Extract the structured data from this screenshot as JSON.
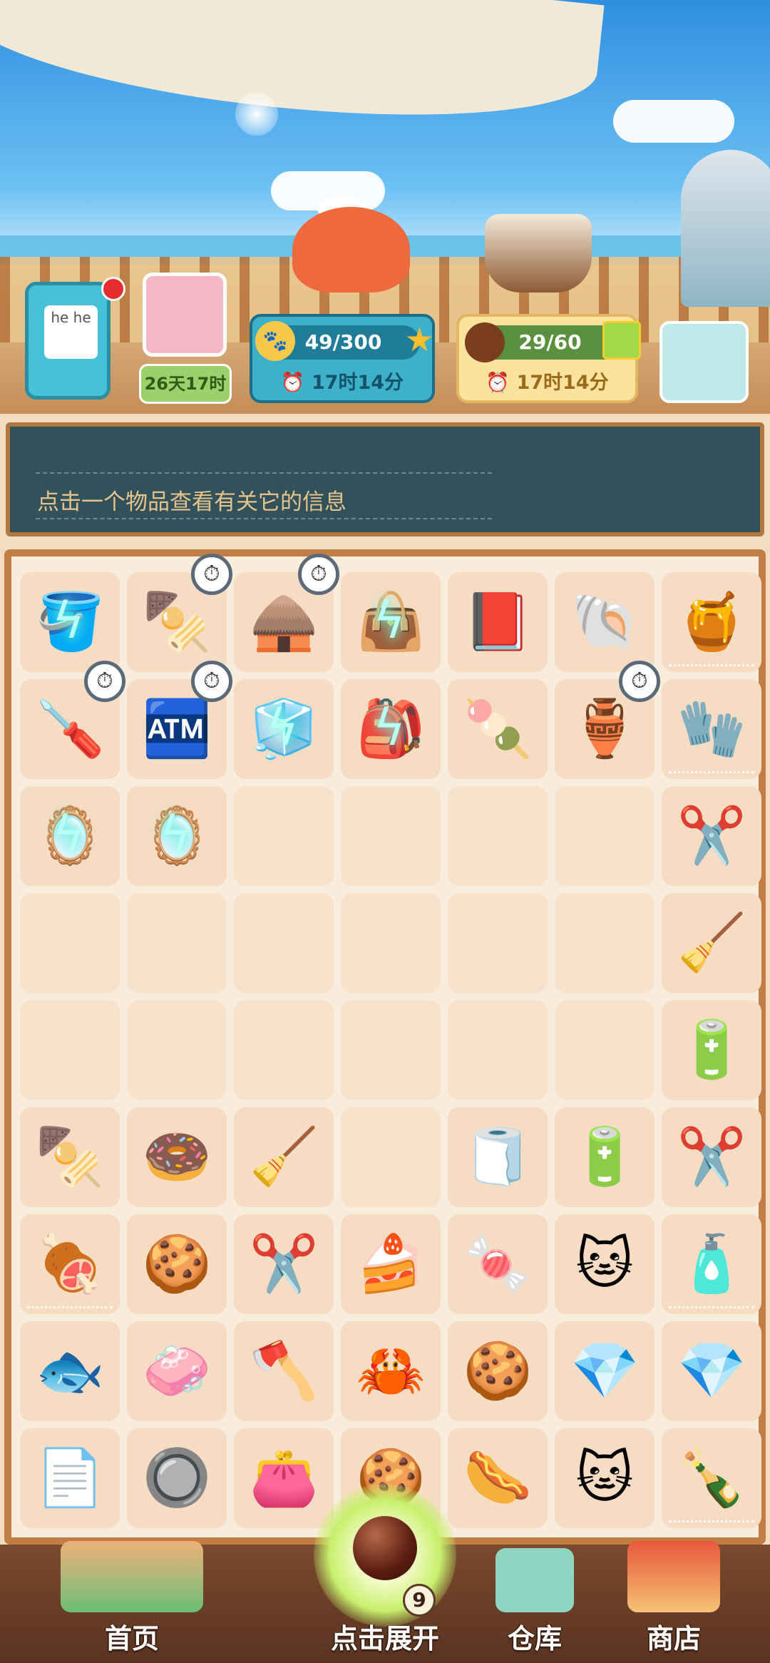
{
  "hud": {
    "avatar_timer": "26天17时",
    "energy": {
      "value": "49/300",
      "timer": "17时14分"
    },
    "cookies": {
      "value": "29/60",
      "timer": "17时14分"
    },
    "journal_text": "he he"
  },
  "info": {
    "message": "点击一个物品查看有关它的信息"
  },
  "board": {
    "cells": [
      {
        "icon": "🪣",
        "bolt": true
      },
      {
        "icon": "🍢",
        "timer": true
      },
      {
        "icon": "🛖",
        "timer": true
      },
      {
        "icon": "👜",
        "bolt": true
      },
      {
        "icon": "📕"
      },
      {
        "icon": "🐚"
      },
      {
        "icon": "🍯",
        "web": true
      },
      {
        "icon": "🪛",
        "timer": true
      },
      {
        "icon": "🏧",
        "timer": true
      },
      {
        "icon": "🧊",
        "bolt": true
      },
      {
        "icon": "🎒",
        "bolt": true
      },
      {
        "icon": "🍡"
      },
      {
        "icon": "🏺",
        "timer": true
      },
      {
        "icon": "🧤",
        "web": true
      },
      {
        "icon": "🪞",
        "bolt": true
      },
      {
        "icon": "🪞",
        "bolt": true
      },
      {},
      {},
      {},
      {},
      {
        "icon": "✂️"
      },
      {},
      {},
      {},
      {},
      {},
      {},
      {
        "icon": "🧹"
      },
      {},
      {},
      {},
      {},
      {},
      {},
      {
        "icon": "🔋"
      },
      {
        "icon": "🍢"
      },
      {
        "icon": "🍩"
      },
      {
        "icon": "🧹"
      },
      {},
      {
        "icon": "🧻"
      },
      {
        "icon": "🔋"
      },
      {
        "icon": "✂️"
      },
      {
        "icon": "🍖",
        "web": true
      },
      {
        "icon": "🍪"
      },
      {
        "icon": "✂️"
      },
      {
        "icon": "🍰"
      },
      {
        "icon": "🍬"
      },
      {
        "icon": "🐱"
      },
      {
        "icon": "🧴",
        "web": true
      },
      {
        "icon": "🐟"
      },
      {
        "icon": "🧼"
      },
      {
        "icon": "🪓"
      },
      {
        "icon": "🦀"
      },
      {
        "icon": "🍪"
      },
      {
        "icon": "💎"
      },
      {
        "icon": "💎"
      },
      {
        "icon": "📄"
      },
      {
        "icon": "🔘"
      },
      {
        "icon": "👛"
      },
      {
        "icon": "🍪"
      },
      {
        "icon": "🌭"
      },
      {
        "icon": "🐱"
      },
      {
        "icon": "🍾",
        "web": true
      }
    ]
  },
  "nav": {
    "home": "首页",
    "expand": "点击展开",
    "expand_badge": "9",
    "warehouse": "仓库",
    "shop": "商店"
  },
  "colors": {
    "board_border": "#c07e45",
    "info_bg": "#32525b",
    "info_text": "#e7c38b"
  }
}
